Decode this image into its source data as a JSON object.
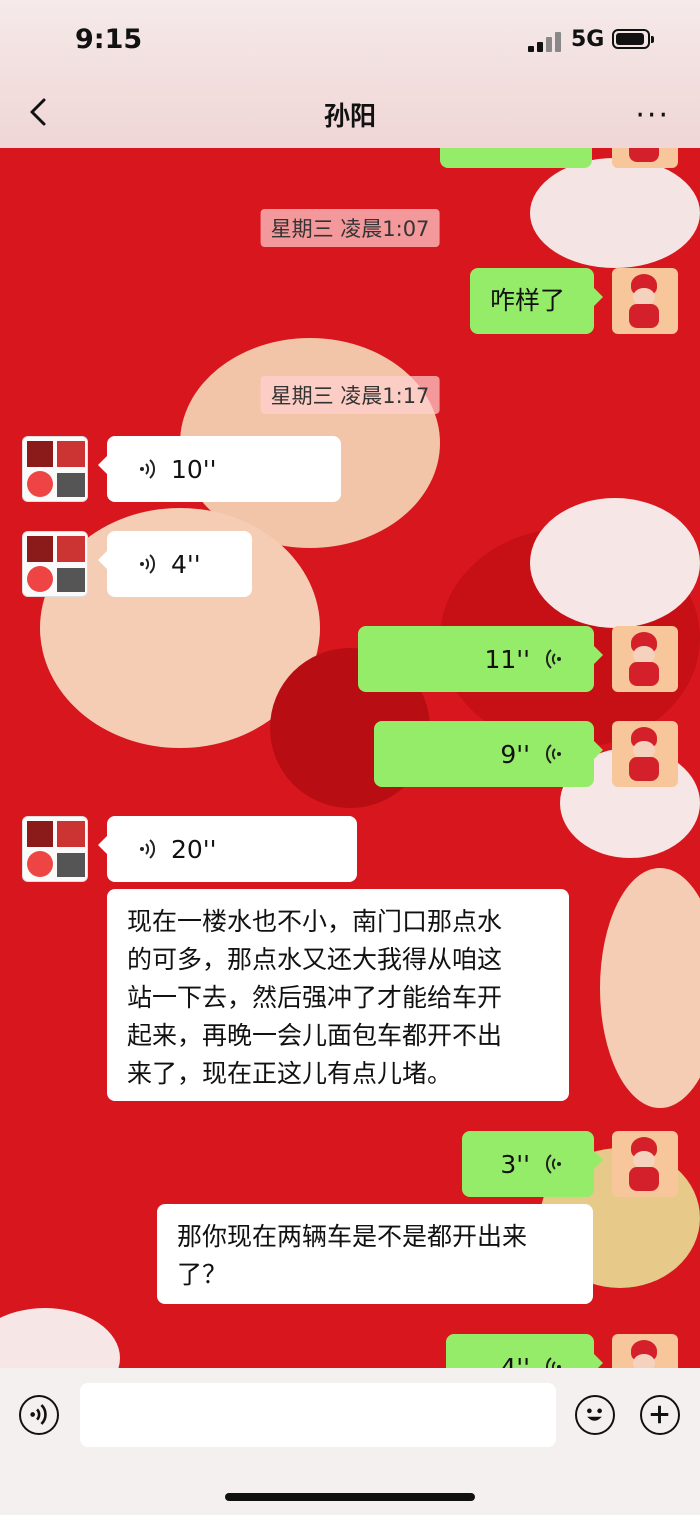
{
  "status_bar": {
    "time": "9:15",
    "network": "5G"
  },
  "nav": {
    "title": "孙阳"
  },
  "messages": {
    "ts1": "星期三 凌晨1:07",
    "m1": "咋样了",
    "ts2": "星期三 凌晨1:17",
    "v1": "10''",
    "v2": "4''",
    "v3": "11''",
    "v4": "9''",
    "v5": "20''",
    "t1_lines": [
      "现在一楼水也不小，南门口那点水",
      "的可多，那点水又还大我得从咱这",
      "站一下去，然后强冲了才能给车开",
      "起来，再晚一会儿面包车都开不出",
      "来了，现在正这儿有点儿堵。"
    ],
    "v6": "3''",
    "t2_lines": [
      "那你现在两辆车是不是都开出来",
      "了？"
    ],
    "v7": "4''"
  },
  "colors": {
    "outgoing": "#95ec69",
    "incoming": "#ffffff",
    "background": "#d8161d"
  },
  "icons": [
    "back-icon",
    "more-icon",
    "voice-wave-icon",
    "emoji-icon",
    "add-icon",
    "voice-input-icon"
  ]
}
